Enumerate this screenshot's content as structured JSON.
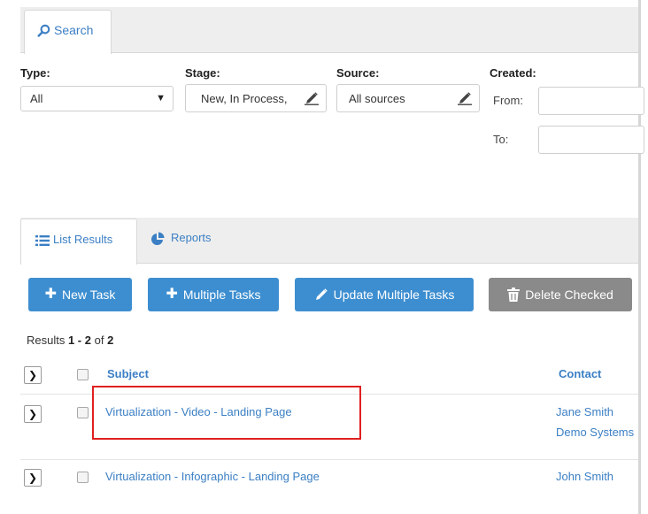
{
  "search_tab": {
    "label": "Search"
  },
  "filters": {
    "type": {
      "label": "Type:",
      "value": "All"
    },
    "stage": {
      "label": "Stage:",
      "value": "New, In Process,"
    },
    "source": {
      "label": "Source:",
      "value": "All sources"
    },
    "created": {
      "label": "Created:",
      "from_label": "From:",
      "to_label": "To:"
    }
  },
  "result_tabs": {
    "list": "List Results",
    "reports": "Reports"
  },
  "toolbar": {
    "new_task": "New Task",
    "multiple_tasks": "Multiple Tasks",
    "update_multiple": "Update Multiple Tasks",
    "delete_checked": "Delete Checked"
  },
  "results_summary": {
    "prefix": "Results ",
    "range": "1 - 2",
    "of": " of ",
    "total": "2"
  },
  "table": {
    "columns": {
      "subject": "Subject",
      "contact": "Contact"
    },
    "rows": [
      {
        "subject": "Virtualization - Video - Landing Page",
        "contact": "Jane Smith",
        "company": "Demo Systems"
      },
      {
        "subject": "Virtualization - Infographic - Landing Page",
        "contact": "John Smith"
      }
    ]
  },
  "colors": {
    "accent": "#3d8ed0",
    "link": "#3b7fc4",
    "delete_button": "#8a8a8a",
    "highlight": "#e02020"
  }
}
